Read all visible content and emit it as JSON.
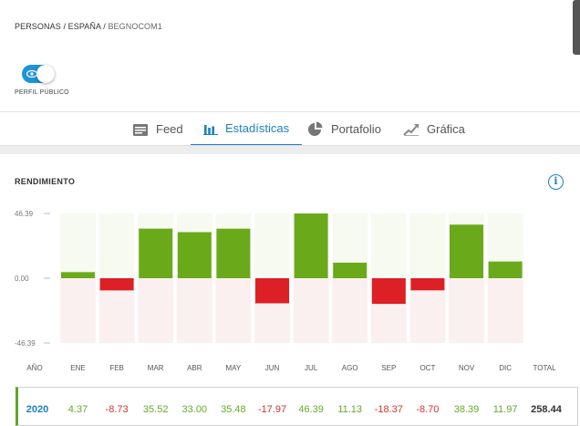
{
  "breadcrumb": {
    "part1": "PERSONAS",
    "sep": "/",
    "part2": "ESPAÑA",
    "current": "BEGNOCOM1"
  },
  "profile_toggle": {
    "label": "PERFIL PÚBLICO",
    "on": true,
    "color": "#1e93d8"
  },
  "tabs": [
    {
      "label": "Feed",
      "icon": "feed-icon",
      "active": false
    },
    {
      "label": "Estadísticas",
      "icon": "bar-chart-icon",
      "active": true
    },
    {
      "label": "Portafolio",
      "icon": "pie-chart-icon",
      "active": false
    },
    {
      "label": "Gráfica",
      "icon": "trend-chart-icon",
      "active": false
    }
  ],
  "section": {
    "title": "RENDIMIENTO",
    "info_icon": "info-icon"
  },
  "chart_data": {
    "type": "bar",
    "categories": [
      "ENE",
      "FEB",
      "MAR",
      "ABR",
      "MAY",
      "JUN",
      "JUL",
      "AGO",
      "SEP",
      "OCT",
      "NOV",
      "DIC"
    ],
    "values": [
      4.37,
      -8.73,
      35.52,
      33.0,
      35.48,
      -17.97,
      46.39,
      11.13,
      -18.37,
      -8.7,
      38.39,
      11.97
    ],
    "ylim": [
      -46.39,
      46.39
    ],
    "y_ticks": [
      "46.39",
      "0.00",
      "-46.39"
    ],
    "colors": {
      "positive": "#6aaa1a",
      "negative": "#dd1f26",
      "positive_bg": "#f6faf1",
      "negative_bg": "#fbf0f0"
    }
  },
  "table": {
    "headers": {
      "year": "AÑO",
      "total": "TOTAL"
    },
    "row": {
      "year": "2020",
      "values": [
        "4.37",
        "-8.73",
        "35.52",
        "33.00",
        "35.48",
        "-17.97",
        "46.39",
        "11.13",
        "-18.37",
        "-8.70",
        "38.39",
        "11.97"
      ],
      "total": "258.44"
    }
  }
}
